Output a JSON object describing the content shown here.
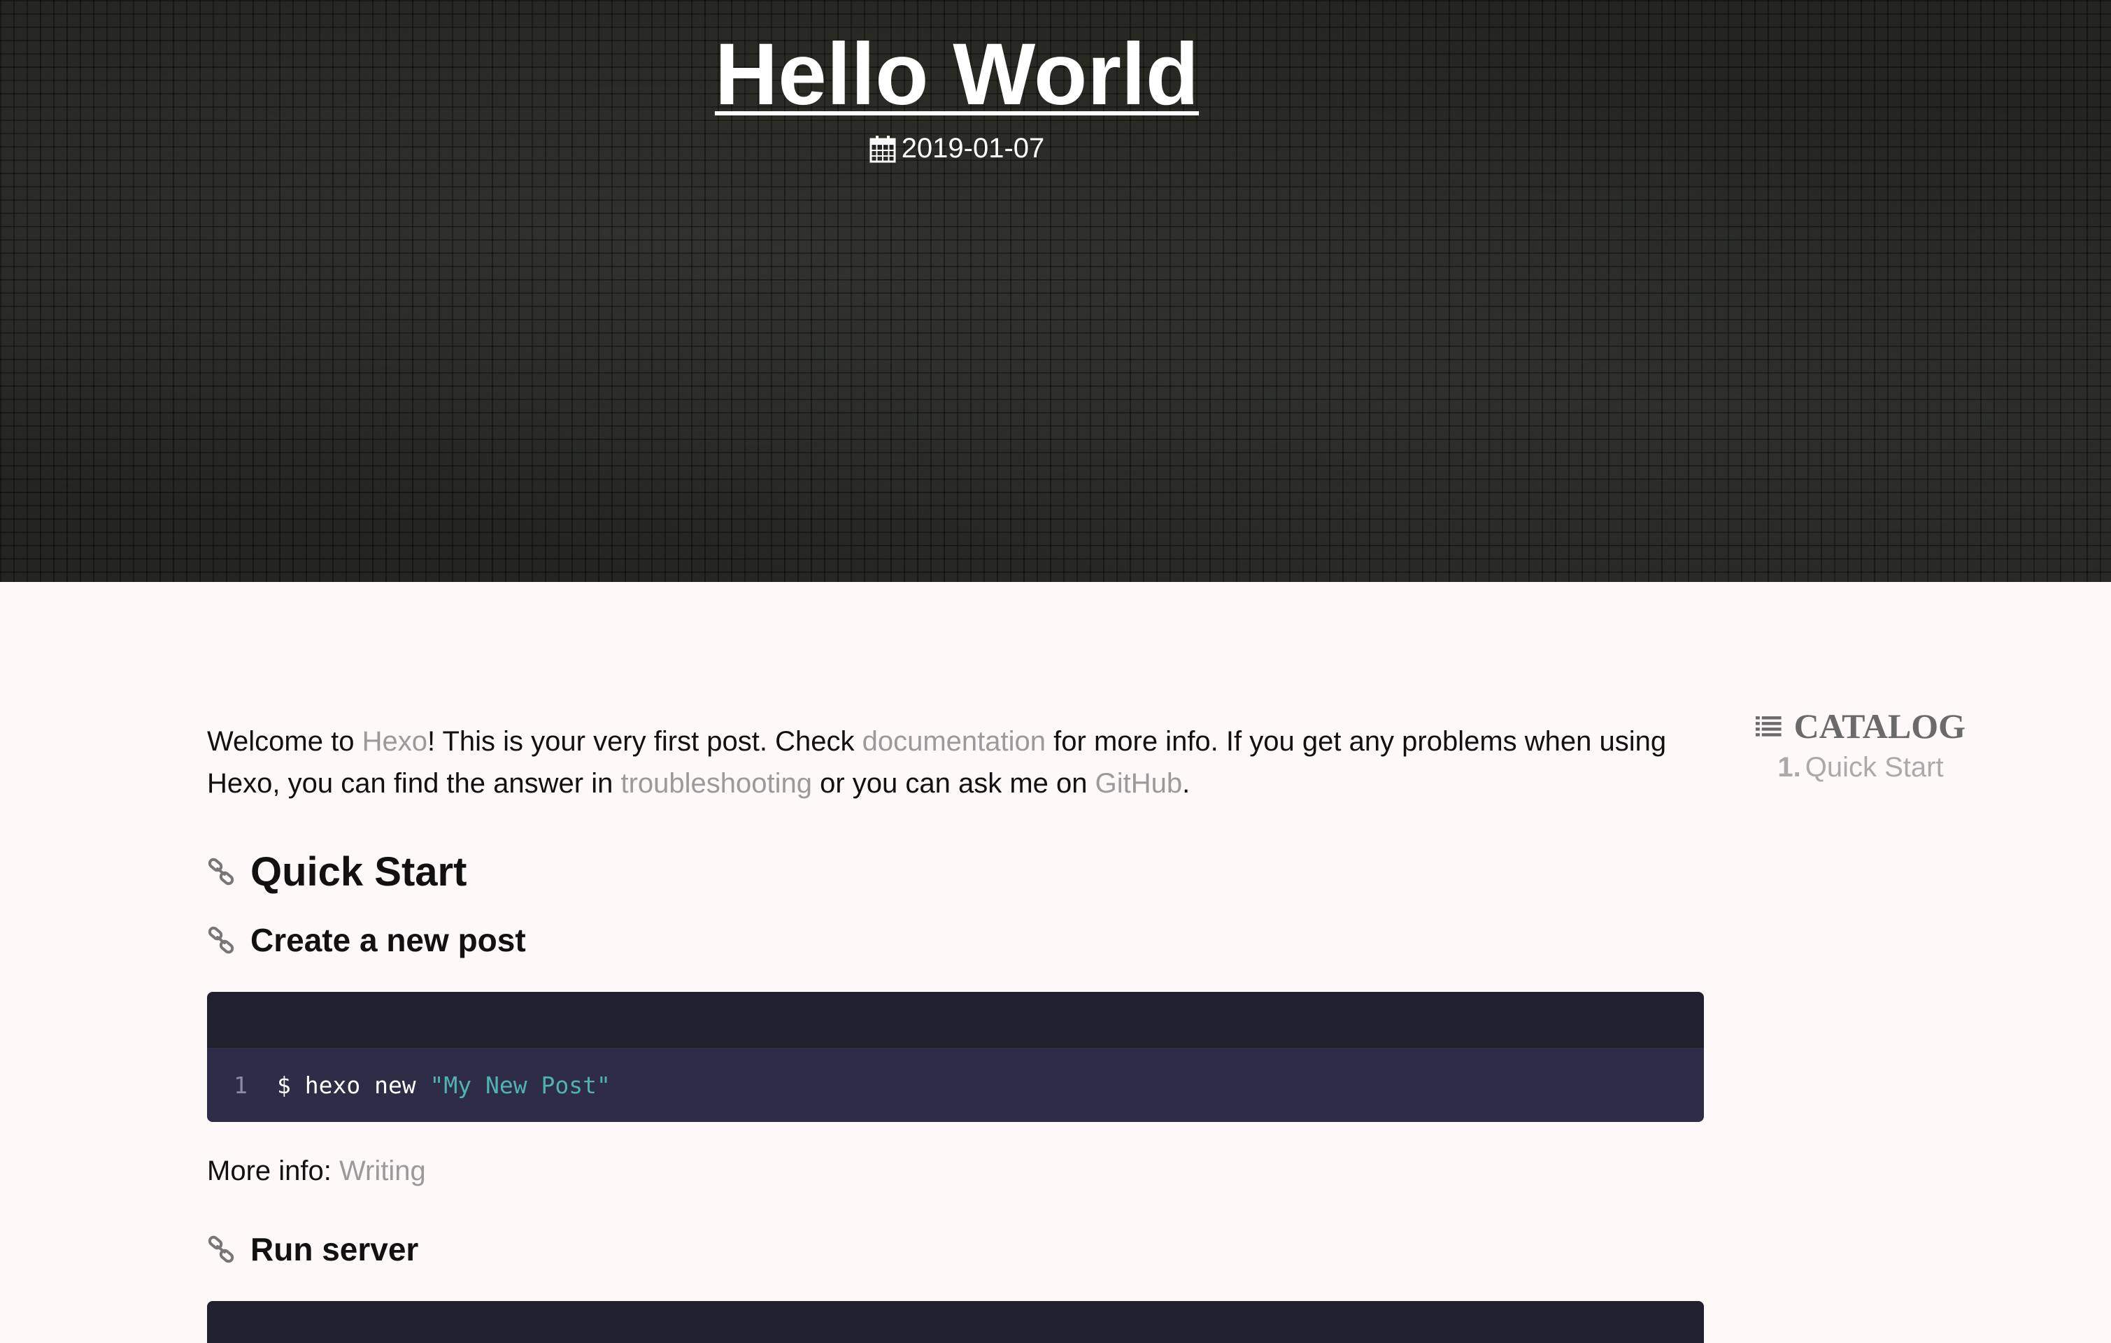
{
  "header": {
    "title": "Hello World",
    "date": "2019-01-07"
  },
  "post": {
    "intro": {
      "t1": "Welcome to ",
      "link_hexo": "Hexo",
      "t2": "! This is your very first post. Check ",
      "link_documentation": "documentation",
      "t3": " for more info. If you get any problems when using Hexo, you can find the answer in ",
      "link_troubleshooting": "troubleshooting",
      "t4": " or you can ask me on ",
      "link_github": "GitHub",
      "t5": "."
    },
    "h2_quick_start": "Quick Start",
    "h3_create_post": "Create a new post",
    "code1": {
      "line_number": "1",
      "command": "$ hexo new ",
      "string": "\"My New Post\""
    },
    "more_info_label": "More info: ",
    "more_info_link": "Writing",
    "h3_run_server": "Run server"
  },
  "catalog": {
    "title": "CATALOG",
    "items": [
      {
        "number": "1.",
        "label": "Quick Start"
      }
    ]
  },
  "colors": {
    "link": "#9a9a9a",
    "code_header": "#21202e",
    "code_body": "#2f2c48",
    "code_string": "#4fb3b3"
  }
}
